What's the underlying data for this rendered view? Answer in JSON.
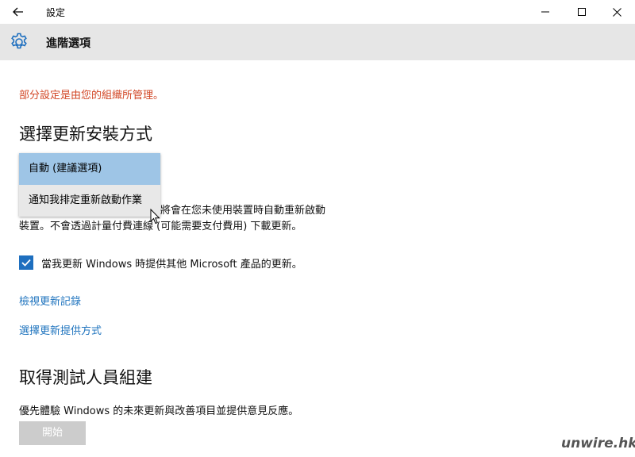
{
  "window": {
    "title": "設定"
  },
  "header": {
    "page_title": "進階選項"
  },
  "notice": "部分設定是由您的組織所管理。",
  "install": {
    "heading": "選擇更新安裝方式",
    "options": [
      "自動 (建議選項)",
      "通知我排定重新啟動作業"
    ],
    "selected_index": 0,
    "description_line1": "將會在您未使用裝置時自動重新啟動",
    "description_line2": "裝置。不會透過計量付費連線 (可能需要支付費用) 下載更新。"
  },
  "checkbox": {
    "label": "當我更新 Windows 時提供其他 Microsoft 產品的更新。",
    "checked": true
  },
  "links": {
    "view_history": "檢視更新記錄",
    "choose_delivery": "選擇更新提供方式"
  },
  "insider": {
    "heading": "取得測試人員組建",
    "description": "優先體驗 Windows 的未來更新與改善項目並提供意見反應。",
    "start_button": "開始"
  },
  "watermark": "unwire.hk",
  "colors": {
    "accent": "#1e6fbf",
    "warning": "#d24726",
    "selected_option": "#9ec5e6"
  }
}
